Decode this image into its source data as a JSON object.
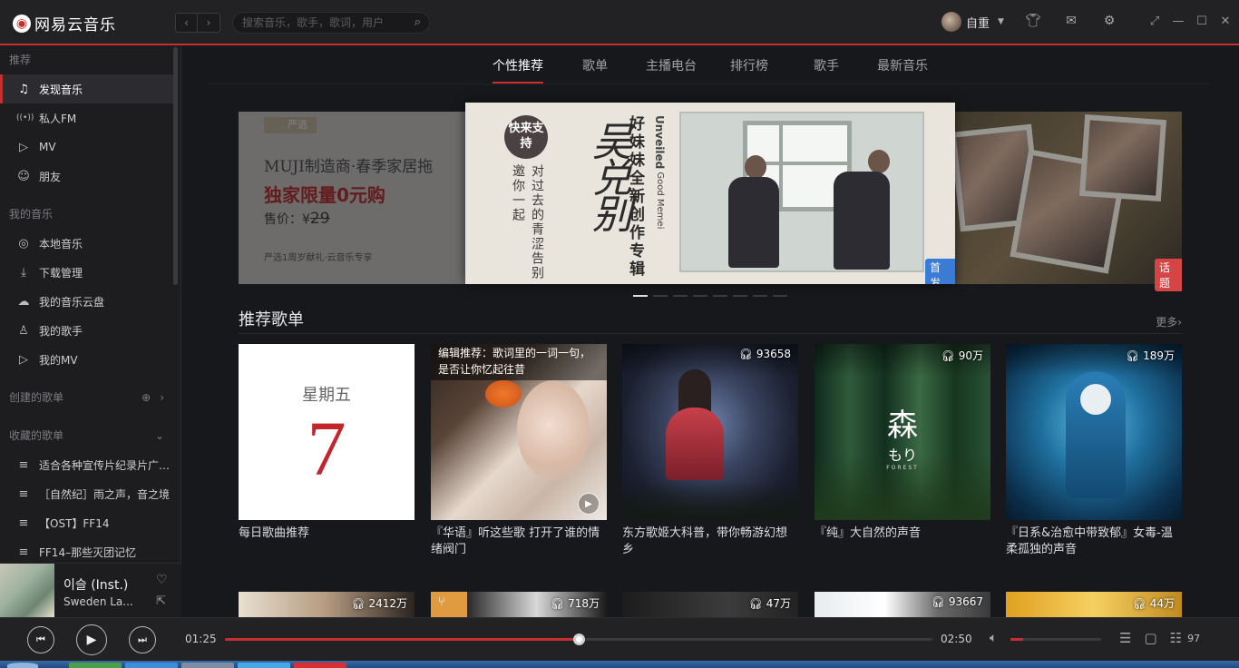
{
  "app": {
    "logo_mark": "◉",
    "logo_text": "网易云音乐"
  },
  "titlebar": {
    "back": "‹",
    "forward": "›",
    "search_placeholder": "搜索音乐，歌手，歌词，用户",
    "user_name": "自重"
  },
  "sidebar": {
    "sections": {
      "recommend": "推荐",
      "my_music": "我的音乐",
      "created": "创建的歌单",
      "collected": "收藏的歌单"
    },
    "recommend_items": [
      {
        "label": "发现音乐",
        "icon": "music-note-icon",
        "glyph": "♫"
      },
      {
        "label": "私人FM",
        "icon": "radio-icon",
        "glyph": "((•))"
      },
      {
        "label": "MV",
        "icon": "video-icon",
        "glyph": "▷"
      },
      {
        "label": "朋友",
        "icon": "friends-icon",
        "glyph": "☺"
      }
    ],
    "my_music_items": [
      {
        "label": "本地音乐",
        "icon": "local-music-icon",
        "glyph": "◎"
      },
      {
        "label": "下载管理",
        "icon": "download-icon",
        "glyph": "⤓"
      },
      {
        "label": "我的音乐云盘",
        "icon": "cloud-icon",
        "glyph": "☁"
      },
      {
        "label": "我的歌手",
        "icon": "singer-icon",
        "glyph": "♙"
      },
      {
        "label": "我的MV",
        "icon": "mv-icon",
        "glyph": "▷"
      }
    ],
    "collected_playlists": [
      "适合各种宣传片纪录片广…",
      "［自然纪］雨之声，音之境",
      "【OST】FF14",
      "FF14–那些灭团记忆"
    ]
  },
  "now_playing": {
    "title": "이슬 (Inst.)",
    "artist": "Sweden La..."
  },
  "tabs": [
    "个性推荐",
    "歌单",
    "主播电台",
    "排行榜",
    "歌手",
    "最新音乐"
  ],
  "banner": {
    "left": {
      "tag": "严选",
      "line1": "MUJI制造商·春季家居拖",
      "line2": "独家限量0元购",
      "price_label": "售价：¥",
      "price": "29",
      "footer": "严选1周岁献礼·云音乐专享"
    },
    "center": {
      "seal": "快来支持",
      "invite": "邀你一起",
      "tagline": "对过去的青涩告别",
      "calligraphy": "吴兑别",
      "album_title": "好妹妹全新创作专辑",
      "english_1": "Unveiled",
      "english_2": "Good Memei",
      "badge": "首发"
    },
    "right": {
      "badge": "话题"
    },
    "dots": 8,
    "active_dot": 0
  },
  "recommend": {
    "title": "推荐歌单",
    "more": "更多›",
    "daily": {
      "weekday": "星期五",
      "day": "7",
      "title": "每日歌曲推荐"
    },
    "playlists": [
      {
        "editor": "编辑推荐：歌词里的一词一句，是否让你忆起往昔",
        "title": "『华语』听这些歌 打开了谁的情绪阀门"
      },
      {
        "plays": "93658",
        "title": "东方歌姬大科普，带你畅游幻想乡"
      },
      {
        "plays": "90万",
        "title": "『纯』大自然的声音",
        "cover_big": "森",
        "cover_small": "もり",
        "cover_en": "FOREST"
      },
      {
        "plays": "189万",
        "title": "『日系&治愈中带致郁』女毒-温柔孤独的声音"
      }
    ],
    "row2_plays": [
      "2412万",
      "718万",
      "47万",
      "93667",
      "44万"
    ]
  },
  "player": {
    "elapsed": "01:25",
    "duration": "02:50",
    "progress": 0.5,
    "volume": 0.14,
    "playlist_count": "97"
  },
  "colors": {
    "accent": "#c62f2f",
    "bg": "#16181c",
    "sidebar": "#1d1d20"
  }
}
